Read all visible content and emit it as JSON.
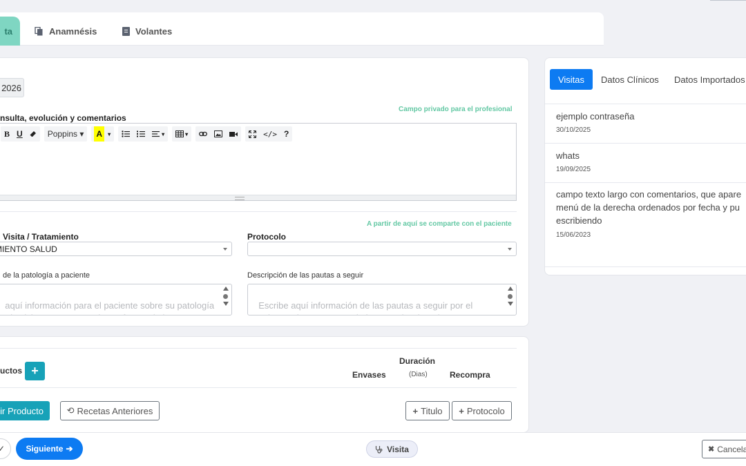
{
  "tabs": [
    {
      "label": "ta",
      "icon": "stethoscope-icon"
    },
    {
      "label": "Anamnésis",
      "icon": "copy-icon"
    },
    {
      "label": "Volantes",
      "icon": "file-icon"
    }
  ],
  "visit": {
    "date_fragment": "2026",
    "notes_label": "nsulta, evolución y comentarios",
    "private_note": "Campo privado para el profesional",
    "shared_note": "A partir de aquí se comparte con el paciente",
    "toolbar": {
      "bold": "B",
      "underline": "U",
      "font": "Poppins",
      "color": "A",
      "help": "?"
    },
    "type_label": "Visita / Tratamiento",
    "type_value": "MIENTO SALUD",
    "protocol_label": "Protocolo",
    "protocol_value": "",
    "pathology_label": "de la patología a paciente",
    "pathology_placeholder": "aquí información para el paciente sobre su patología\no de visita, como recuerdo y refuerzo de la",
    "guidelines_label": "Descripción de las pautas a seguir",
    "guidelines_placeholder": "Escribe aquí información de las pautas a seguir por el\npaciente, siempre y cuando hayas seleccionado un"
  },
  "products": {
    "title": "uctos",
    "col_envases": "Envases",
    "col_duracion": "Duración",
    "col_dias": "(Dias)",
    "col_recompra": "Recompra",
    "add_product": "ir Producto",
    "previous_recipes": "Recetas Anteriores",
    "title_btn": "Titulo",
    "protocol_btn": "Protocolo"
  },
  "right_panel": {
    "tabs": [
      "Visitas",
      "Datos Clínicos",
      "Datos Importados"
    ],
    "visits": [
      {
        "title": "ejemplo contraseña",
        "date": "30/10/2025"
      },
      {
        "title": "whats",
        "date": "19/09/2025"
      },
      {
        "title": "campo texto largo con comentarios, que apare\nmenú de la derecha ordenados por fecha y pu\nescribiendo",
        "date": "15/06/2023"
      }
    ]
  },
  "bottom": {
    "next": "Siguiente",
    "visit": "Visita",
    "cancel": "Cancelar"
  }
}
